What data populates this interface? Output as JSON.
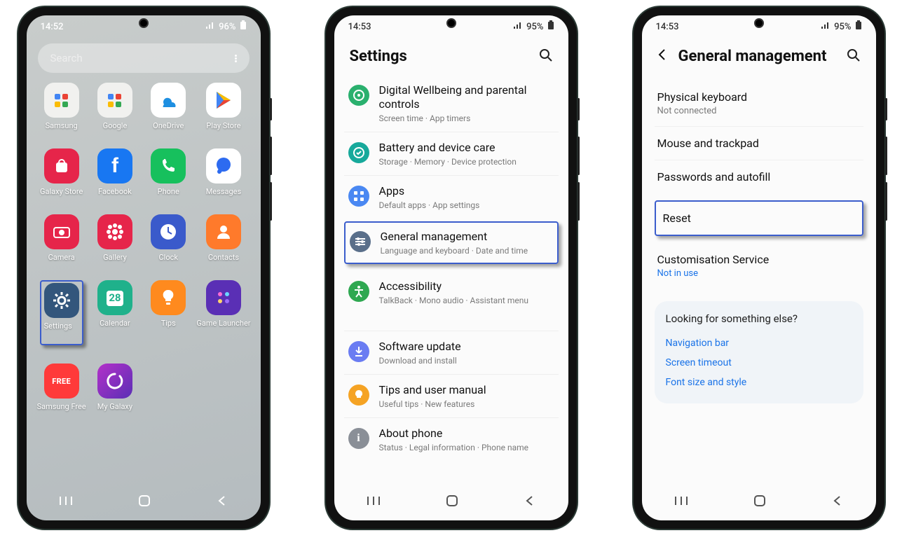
{
  "phone1": {
    "status": {
      "time": "14:52",
      "battery": "96%"
    },
    "search_placeholder": "Search",
    "apps": [
      {
        "label": "Samsung",
        "bg": "#f1f1ef",
        "glyph": "sq"
      },
      {
        "label": "Google",
        "bg": "#f1f1ef",
        "glyph": "sq"
      },
      {
        "label": "OneDrive",
        "bg": "#ffffff",
        "glyph": "cloud",
        "fg": "#1e8fe1"
      },
      {
        "label": "Play Store",
        "bg": "#ffffff",
        "glyph": "play"
      },
      {
        "label": "Galaxy Store",
        "bg": "#e6254a",
        "glyph": "bag",
        "fg": "#fff"
      },
      {
        "label": "Facebook",
        "bg": "#1877f2",
        "glyph": "f",
        "fg": "#fff"
      },
      {
        "label": "Phone",
        "bg": "#17c05d",
        "glyph": "phone",
        "fg": "#fff"
      },
      {
        "label": "Messages",
        "bg": "#ffffff",
        "glyph": "msg",
        "fg": "#2d6bf0"
      },
      {
        "label": "Camera",
        "bg": "#e6254a",
        "glyph": "cam",
        "fg": "#fff"
      },
      {
        "label": "Gallery",
        "bg": "#e6254a",
        "glyph": "flower",
        "fg": "#fff"
      },
      {
        "label": "Clock",
        "bg": "#3a5acb",
        "glyph": "clock",
        "fg": "#fff"
      },
      {
        "label": "Contacts",
        "bg": "#ff7a2b",
        "glyph": "person",
        "fg": "#fff"
      },
      {
        "label": "Settings",
        "bg": "#33567c",
        "glyph": "gear",
        "fg": "#fff",
        "highlighted": true
      },
      {
        "label": "Calendar",
        "bg": "#1fb18b",
        "glyph": "cal",
        "fg": "#fff",
        "cal_day": "28"
      },
      {
        "label": "Tips",
        "bg": "#ff8a1e",
        "glyph": "bulb",
        "fg": "#fff"
      },
      {
        "label": "Game Launcher",
        "bg": "#5a2fb5",
        "glyph": "dots",
        "fg": "#fff"
      },
      {
        "label": "Samsung Free",
        "bg": "#ff3a3a",
        "glyph": "free",
        "fg": "#fff",
        "text": "FREE"
      },
      {
        "label": "My Galaxy",
        "bg": "linear-gradient(135deg,#b330c9,#5a2fb5)",
        "glyph": "swirl",
        "fg": "#fff"
      }
    ]
  },
  "phone2": {
    "status": {
      "time": "14:53",
      "battery": "95%"
    },
    "title": "Settings",
    "items": [
      {
        "icon_bg": "#2ab06e",
        "icon": "target",
        "title": "Digital Wellbeing and parental controls",
        "sub": "Screen time  ·  App timers"
      },
      {
        "icon_bg": "#17a99b",
        "icon": "care",
        "title": "Battery and device care",
        "sub": "Storage  ·  Memory  ·  Device protection"
      },
      {
        "icon_bg": "#4a88f2",
        "icon": "apps",
        "title": "Apps",
        "sub": "Default apps  ·  App settings"
      },
      {
        "icon_bg": "#5a6f8a",
        "icon": "sliders",
        "title": "General management",
        "sub": "Language and keyboard  ·  Date and time",
        "highlighted": true
      },
      {
        "icon_bg": "#2fa851",
        "icon": "a11y",
        "title": "Accessibility",
        "sub": "TalkBack  ·  Mono audio  ·  Assistant menu",
        "gap_after": true
      },
      {
        "icon_bg": "#6a7cf2",
        "icon": "dl",
        "title": "Software update",
        "sub": "Download and install"
      },
      {
        "icon_bg": "#f5a324",
        "icon": "bulb",
        "title": "Tips and user manual",
        "sub": "Useful tips  ·  New features"
      },
      {
        "icon_bg": "#8a8f97",
        "icon": "info",
        "title": "About phone",
        "sub": "Status  ·  Legal information  ·  Phone name"
      }
    ]
  },
  "phone3": {
    "status": {
      "time": "14:53",
      "battery": "95%"
    },
    "title": "General management",
    "items": [
      {
        "title": "Physical keyboard",
        "sub": "Not connected"
      },
      {
        "title": "Mouse and trackpad"
      },
      {
        "title": "Passwords and autofill"
      },
      {
        "title": "Reset",
        "highlighted": true
      },
      {
        "title": "Customisation Service",
        "sub": "Not in use",
        "sub_link": true
      }
    ],
    "suggest": {
      "title": "Looking for something else?",
      "links": [
        "Navigation bar",
        "Screen timeout",
        "Font size and style"
      ]
    }
  }
}
